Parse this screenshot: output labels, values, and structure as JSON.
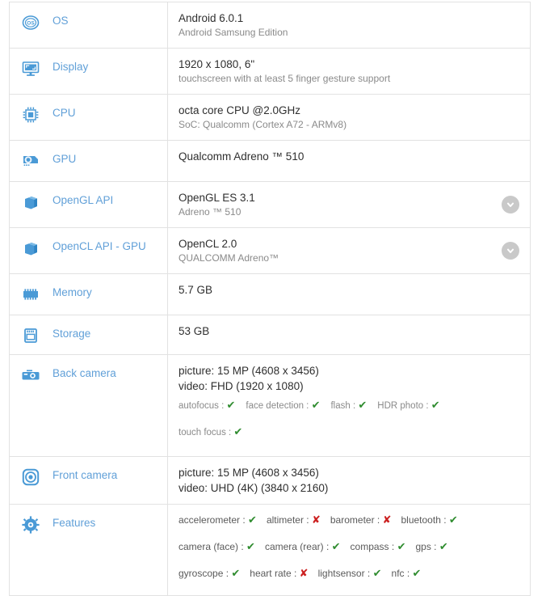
{
  "theme": {
    "label_color": "#61a0d8",
    "value_color": "#2f2f2f",
    "secondary_color": "#8a8a8a",
    "border_color": "#e2e2e2",
    "yes_color": "#2f8c2f",
    "no_color": "#cc2020",
    "chevron_bg": "#c9c9c9"
  },
  "rows": {
    "os": {
      "label": "OS",
      "icon": "os-badge-icon",
      "primary": "Android 6.0.1",
      "secondary": "Android Samsung Edition"
    },
    "display": {
      "label": "Display",
      "icon": "monitor-icon",
      "primary": "1920 x 1080, 6\"",
      "secondary": "touchscreen with at least 5 finger gesture support"
    },
    "cpu": {
      "label": "CPU",
      "icon": "cpu-chip-icon",
      "primary": "octa core CPU @2.0GHz",
      "secondary": "SoC: Qualcomm (Cortex A72 - ARMv8)"
    },
    "gpu": {
      "label": "GPU",
      "icon": "graphics-card-icon",
      "primary": "Qualcomm Adreno ™ 510",
      "secondary": ""
    },
    "opengl": {
      "label": "OpenGL API",
      "icon": "cube-icon",
      "primary": "OpenGL ES 3.1",
      "secondary": "Adreno ™ 510",
      "expand_icon": "chevron-down-icon"
    },
    "opencl": {
      "label": "OpenCL API - GPU",
      "icon": "cube-icon",
      "primary": "OpenCL 2.0",
      "secondary": "QUALCOMM Adreno™",
      "expand_icon": "chevron-down-icon"
    },
    "memory": {
      "label": "Memory",
      "icon": "memory-chip-icon",
      "primary": "5.7 GB",
      "secondary": ""
    },
    "storage": {
      "label": "Storage",
      "icon": "storage-card-icon",
      "primary": "53 GB",
      "secondary": ""
    },
    "back_camera": {
      "label": "Back camera",
      "icon": "camera-icon",
      "primary": "picture: 15 MP (4608 x 3456)",
      "secondary": "video: FHD (1920 x 1080)",
      "features_line1": [
        {
          "name": "autofocus :",
          "supported": true
        },
        {
          "name": "face detection :",
          "supported": true
        },
        {
          "name": "flash :",
          "supported": true
        },
        {
          "name": "HDR photo :",
          "supported": true
        }
      ],
      "features_line2": [
        {
          "name": "touch focus :",
          "supported": true
        }
      ]
    },
    "front_camera": {
      "label": "Front camera",
      "icon": "front-camera-icon",
      "primary": "picture: 15 MP (4608 x 3456)",
      "secondary": "video: UHD (4K) (3840 x 2160)"
    },
    "features": {
      "label": "Features",
      "icon": "gear-icon",
      "sensors_line1": [
        {
          "name": "accelerometer :",
          "supported": true
        },
        {
          "name": "altimeter :",
          "supported": false
        },
        {
          "name": "barometer :",
          "supported": false
        },
        {
          "name": "bluetooth :",
          "supported": true
        }
      ],
      "sensors_line2": [
        {
          "name": "camera (face) :",
          "supported": true
        },
        {
          "name": "camera (rear) :",
          "supported": true
        },
        {
          "name": "compass :",
          "supported": true
        },
        {
          "name": "gps :",
          "supported": true
        }
      ],
      "sensors_line3": [
        {
          "name": "gyroscope :",
          "supported": true
        },
        {
          "name": "heart rate :",
          "supported": false
        },
        {
          "name": "lightsensor :",
          "supported": true
        },
        {
          "name": "nfc :",
          "supported": true
        }
      ]
    }
  },
  "glyphs": {
    "yes": "✔",
    "no": "✘"
  }
}
